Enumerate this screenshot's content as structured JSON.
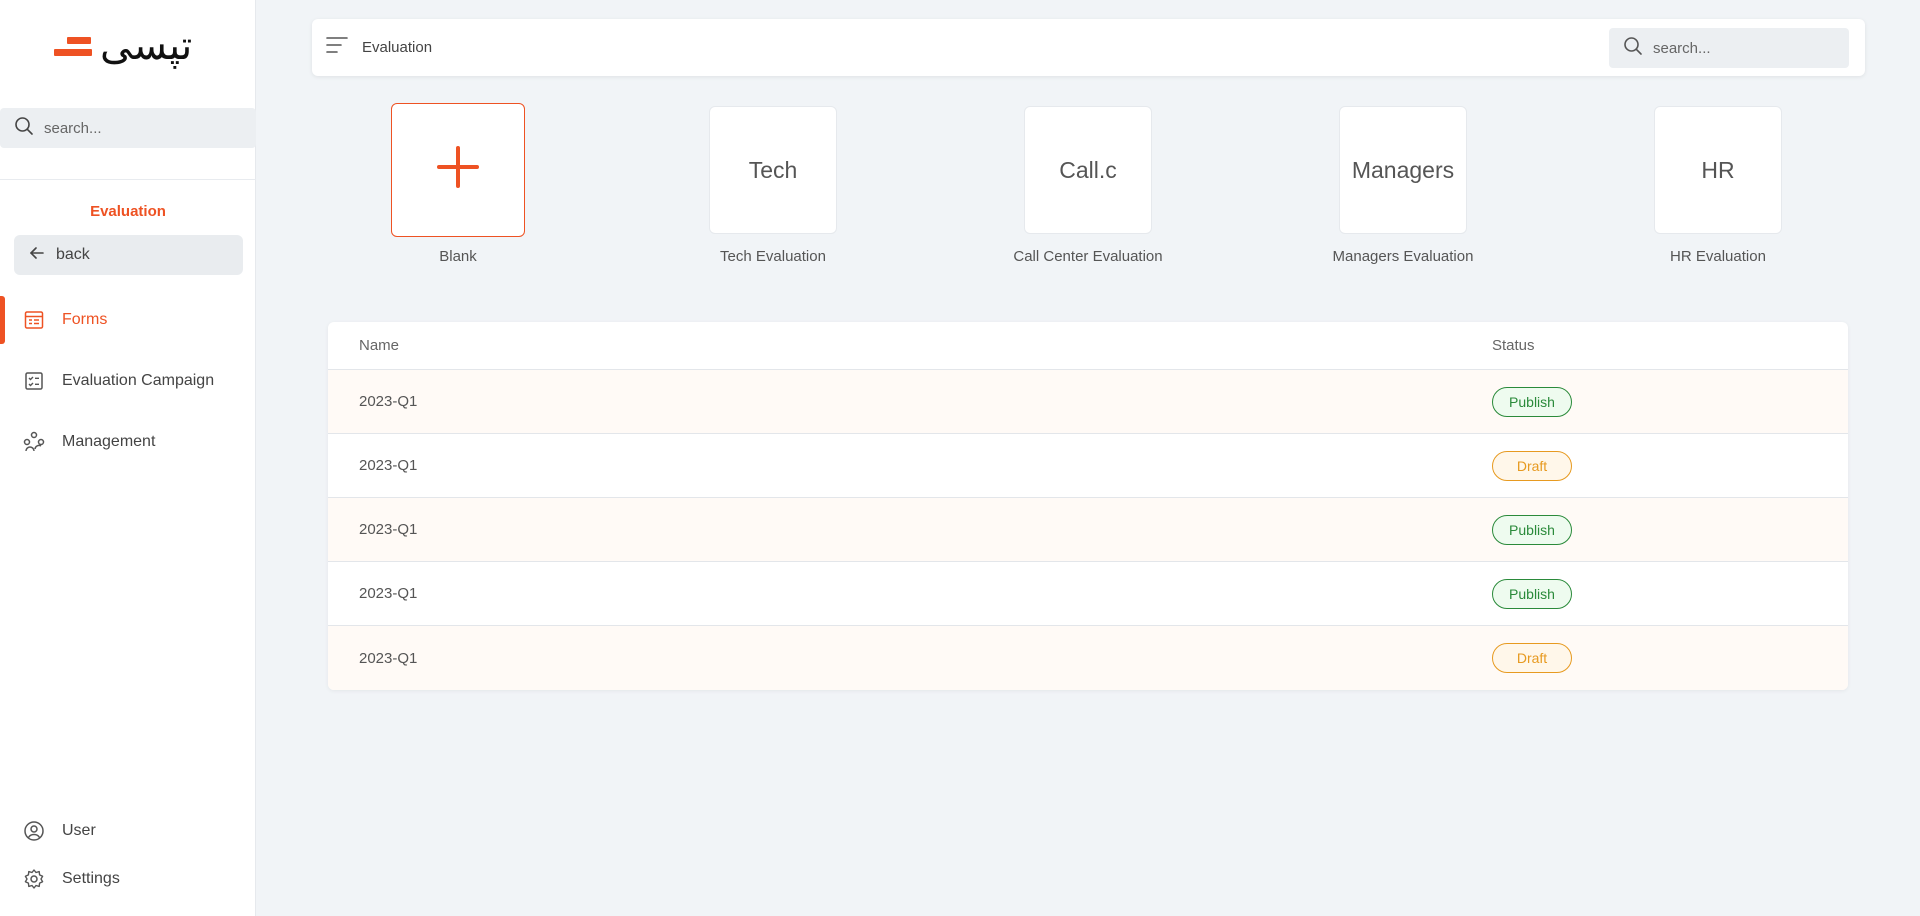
{
  "logo": {
    "text": "تپسی"
  },
  "sidebar": {
    "search_placeholder": "search...",
    "section_title": "Evaluation",
    "back_label": "back",
    "items": [
      {
        "label": "Forms",
        "icon": "form-icon",
        "active": true
      },
      {
        "label": "Evaluation Campaign",
        "icon": "checklist-icon",
        "active": false
      },
      {
        "label": "Management",
        "icon": "people-icon",
        "active": false
      }
    ],
    "bottom_items": [
      {
        "label": "User",
        "icon": "user-icon"
      },
      {
        "label": "Settings",
        "icon": "gear-icon"
      }
    ]
  },
  "topbar": {
    "title": "Evaluation",
    "search_placeholder": "search..."
  },
  "templates": [
    {
      "card_text": "",
      "label": "Blank",
      "icon": "plus-icon"
    },
    {
      "card_text": "Tech",
      "label": "Tech Evaluation"
    },
    {
      "card_text": "Call.c",
      "label": "Call Center Evaluation"
    },
    {
      "card_text": "Managers",
      "label": "Managers Evaluation"
    },
    {
      "card_text": "HR",
      "label": "HR Evaluation"
    }
  ],
  "table": {
    "headers": {
      "name": "Name",
      "status": "Status"
    },
    "rows": [
      {
        "name": "2023-Q1",
        "status": "Publish"
      },
      {
        "name": "2023-Q1",
        "status": "Draft"
      },
      {
        "name": "2023-Q1",
        "status": "Publish"
      },
      {
        "name": "2023-Q1",
        "status": "Publish"
      },
      {
        "name": "2023-Q1",
        "status": "Draft"
      }
    ]
  },
  "colors": {
    "accent": "#ee5223",
    "publish": "#2a8a3a",
    "draft": "#e79a20"
  }
}
